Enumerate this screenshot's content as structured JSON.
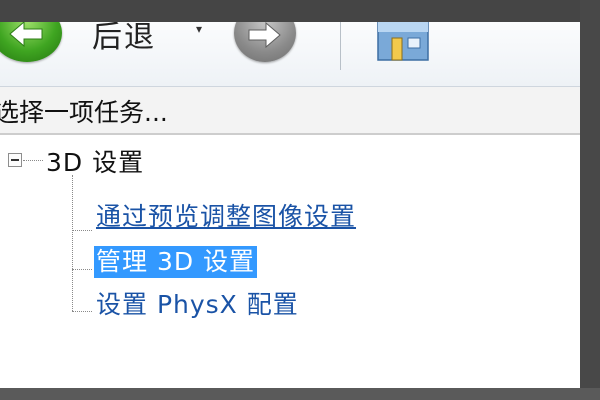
{
  "toolbar": {
    "back_label": "后退",
    "dropdown_glyph": "▾"
  },
  "task_header": {
    "text": "选择一项任务..."
  },
  "tree": {
    "root_label": "3D 设置",
    "items": [
      {
        "label": "通过预览调整图像设置",
        "state": "link"
      },
      {
        "label": "管理 3D 设置",
        "state": "selected"
      },
      {
        "label": "设置 PhysX 配置",
        "state": "normal"
      }
    ]
  },
  "colors": {
    "selection": "#3399ff",
    "link": "#1a53a6",
    "back_green": "#3fa521",
    "forward_gray": "#8a8a8a"
  },
  "icons": {
    "back": "arrow-left-icon",
    "forward": "arrow-right-icon",
    "home": "home-icon",
    "expander": "minus-box-icon"
  }
}
